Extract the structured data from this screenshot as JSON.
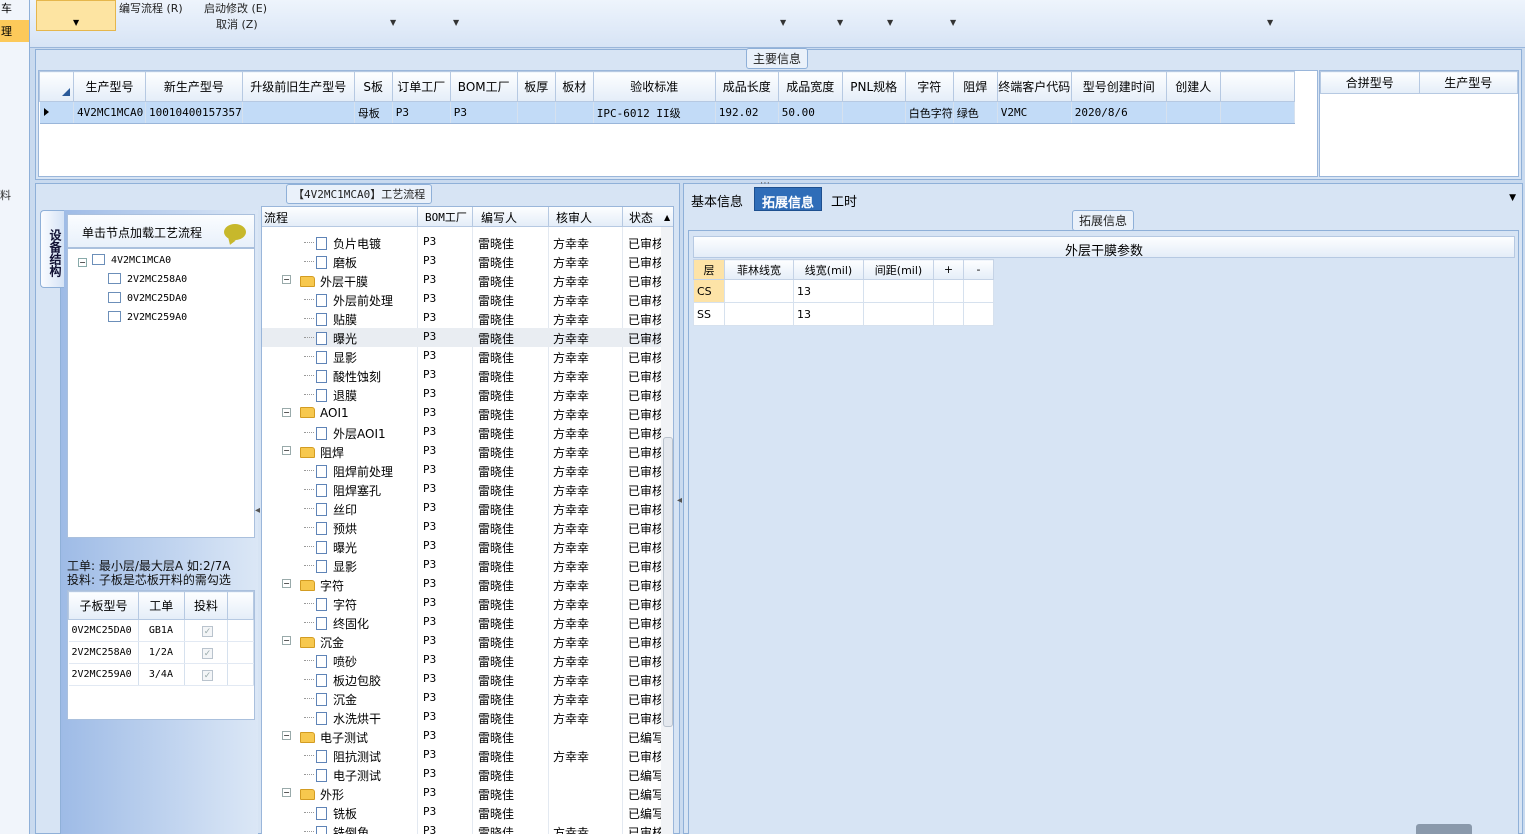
{
  "left_strip": {
    "item_top": "车",
    "item_active": "理",
    "item_mid": "料"
  },
  "toolbar": {
    "edit_flow": "编写流程 (R)",
    "start_modify": "启动修改 (E)",
    "cancel": "取消 (Z)"
  },
  "main_info": {
    "title": "主要信息",
    "columns": [
      "生产型号",
      "新生产型号",
      "升级前旧生产型号",
      "S板",
      "订单工厂",
      "BOM工厂",
      "板厚",
      "板材",
      "验收标准",
      "成品长度",
      "成品宽度",
      "PNL规格",
      "字符",
      "阻焊",
      "终端客户代码",
      "型号创建时间",
      "创建人"
    ],
    "row": [
      "4V2MC1MCA0",
      "10010400157357",
      "",
      "母板",
      "P3",
      "P3",
      "",
      "",
      "IPC-6012 II级",
      "192.02",
      "50.00",
      "",
      "白色字符",
      "绿色",
      "V2MC",
      "2020/8/6",
      ""
    ],
    "merge_columns": [
      "合拼型号",
      "生产型号"
    ]
  },
  "process_panel": {
    "title": "【4V2MC1MCA0】工艺流程",
    "vertical_tab": "设备结构",
    "hint": "单击节点加载工艺流程",
    "tree": {
      "root": "4V2MC1MCA0",
      "children": [
        "2V2MC258A0",
        "0V2MC25DA0",
        "2V2MC259A0"
      ]
    },
    "note_line1": "工单: 最小层/最大层A 如:2/7A",
    "note_line2": "投料: 子板是芯板开料的需勾选",
    "sub_columns": [
      "子板型号",
      "工单",
      "投料"
    ],
    "sub_rows": [
      {
        "model": "0V2MC25DA0",
        "order": "GB1A",
        "check": "✓"
      },
      {
        "model": "2V2MC258A0",
        "order": "1/2A",
        "check": "✓"
      },
      {
        "model": "2V2MC259A0",
        "order": "3/4A",
        "check": "✓"
      }
    ],
    "flow_columns": [
      "流程",
      "BOM工厂",
      "编写人",
      "核审人",
      "状态"
    ],
    "flow_rows": [
      {
        "name": "负片电镀",
        "type": "doc",
        "bom": "P3",
        "writer": "雷晓佳",
        "auditor": "方幸幸",
        "status": "已审核"
      },
      {
        "name": "磨板",
        "type": "doc",
        "bom": "P3",
        "writer": "雷晓佳",
        "auditor": "方幸幸",
        "status": "已审核"
      },
      {
        "name": "外层干膜",
        "type": "folder",
        "bom": "P3",
        "writer": "雷晓佳",
        "auditor": "方幸幸",
        "status": "已审核"
      },
      {
        "name": "外层前处理",
        "type": "doc",
        "bom": "P3",
        "writer": "雷晓佳",
        "auditor": "方幸幸",
        "status": "已审核"
      },
      {
        "name": "贴膜",
        "type": "doc",
        "bom": "P3",
        "writer": "雷晓佳",
        "auditor": "方幸幸",
        "status": "已审核"
      },
      {
        "name": "曝光",
        "type": "doc",
        "bom": "P3",
        "writer": "雷晓佳",
        "auditor": "方幸幸",
        "status": "已审核"
      },
      {
        "name": "显影",
        "type": "doc",
        "bom": "P3",
        "writer": "雷晓佳",
        "auditor": "方幸幸",
        "status": "已审核"
      },
      {
        "name": "酸性蚀刻",
        "type": "doc",
        "bom": "P3",
        "writer": "雷晓佳",
        "auditor": "方幸幸",
        "status": "已审核"
      },
      {
        "name": "退膜",
        "type": "doc",
        "bom": "P3",
        "writer": "雷晓佳",
        "auditor": "方幸幸",
        "status": "已审核"
      },
      {
        "name": "AOI1",
        "type": "folder",
        "bom": "P3",
        "writer": "雷晓佳",
        "auditor": "方幸幸",
        "status": "已审核"
      },
      {
        "name": "外层AOI1",
        "type": "doc",
        "bom": "P3",
        "writer": "雷晓佳",
        "auditor": "方幸幸",
        "status": "已审核"
      },
      {
        "name": "阻焊",
        "type": "folder",
        "bom": "P3",
        "writer": "雷晓佳",
        "auditor": "方幸幸",
        "status": "已审核"
      },
      {
        "name": "阻焊前处理",
        "type": "doc",
        "bom": "P3",
        "writer": "雷晓佳",
        "auditor": "方幸幸",
        "status": "已审核"
      },
      {
        "name": "阻焊塞孔",
        "type": "doc",
        "bom": "P3",
        "writer": "雷晓佳",
        "auditor": "方幸幸",
        "status": "已审核"
      },
      {
        "name": "丝印",
        "type": "doc",
        "bom": "P3",
        "writer": "雷晓佳",
        "auditor": "方幸幸",
        "status": "已审核"
      },
      {
        "name": "预烘",
        "type": "doc",
        "bom": "P3",
        "writer": "雷晓佳",
        "auditor": "方幸幸",
        "status": "已审核"
      },
      {
        "name": "曝光",
        "type": "doc",
        "bom": "P3",
        "writer": "雷晓佳",
        "auditor": "方幸幸",
        "status": "已审核"
      },
      {
        "name": "显影",
        "type": "doc",
        "bom": "P3",
        "writer": "雷晓佳",
        "auditor": "方幸幸",
        "status": "已审核"
      },
      {
        "name": "字符",
        "type": "folder",
        "bom": "P3",
        "writer": "雷晓佳",
        "auditor": "方幸幸",
        "status": "已审核"
      },
      {
        "name": "字符",
        "type": "doc",
        "bom": "P3",
        "writer": "雷晓佳",
        "auditor": "方幸幸",
        "status": "已审核"
      },
      {
        "name": "终固化",
        "type": "doc",
        "bom": "P3",
        "writer": "雷晓佳",
        "auditor": "方幸幸",
        "status": "已审核"
      },
      {
        "name": "沉金",
        "type": "folder",
        "bom": "P3",
        "writer": "雷晓佳",
        "auditor": "方幸幸",
        "status": "已审核"
      },
      {
        "name": "喷砂",
        "type": "doc",
        "bom": "P3",
        "writer": "雷晓佳",
        "auditor": "方幸幸",
        "status": "已审核"
      },
      {
        "name": "板边包胶",
        "type": "doc",
        "bom": "P3",
        "writer": "雷晓佳",
        "auditor": "方幸幸",
        "status": "已审核"
      },
      {
        "name": "沉金",
        "type": "doc",
        "bom": "P3",
        "writer": "雷晓佳",
        "auditor": "方幸幸",
        "status": "已审核"
      },
      {
        "name": "水洗烘干",
        "type": "doc",
        "bom": "P3",
        "writer": "雷晓佳",
        "auditor": "方幸幸",
        "status": "已审核"
      },
      {
        "name": "电子测试",
        "type": "folder",
        "bom": "P3",
        "writer": "雷晓佳",
        "auditor": "",
        "status": "已编写"
      },
      {
        "name": "阻抗测试",
        "type": "doc",
        "bom": "P3",
        "writer": "雷晓佳",
        "auditor": "方幸幸",
        "status": "已审核"
      },
      {
        "name": "电子测试",
        "type": "doc",
        "bom": "P3",
        "writer": "雷晓佳",
        "auditor": "",
        "status": "已编写"
      },
      {
        "name": "外形",
        "type": "folder",
        "bom": "P3",
        "writer": "雷晓佳",
        "auditor": "",
        "status": "已编写"
      },
      {
        "name": "铣板",
        "type": "doc",
        "bom": "P3",
        "writer": "雷晓佳",
        "auditor": "",
        "status": "已编写"
      },
      {
        "name": "铣倒角",
        "type": "doc",
        "bom": "P3",
        "writer": "雷晓佳",
        "auditor": "方幸幸",
        "status": "已审核"
      }
    ]
  },
  "right_panel": {
    "tabs": [
      "基本信息",
      "拓展信息",
      "工时"
    ],
    "active_tab": "拓展信息",
    "group_title": "拓展信息",
    "dry_film_title": "外层干膜参数",
    "dry_columns": [
      "层",
      "菲林线宽",
      "线宽(mil)",
      "间距(mil)",
      "+",
      "-"
    ],
    "dry_rows": [
      {
        "layer": "CS",
        "film": "",
        "width": "13",
        "space": ""
      },
      {
        "layer": "SS",
        "film": "",
        "width": "13",
        "space": ""
      }
    ],
    "colors": {
      "tab_active": "#2f6db8",
      "layer_header": "#fde3a7",
      "row_selected": "#c2dbf7"
    }
  }
}
